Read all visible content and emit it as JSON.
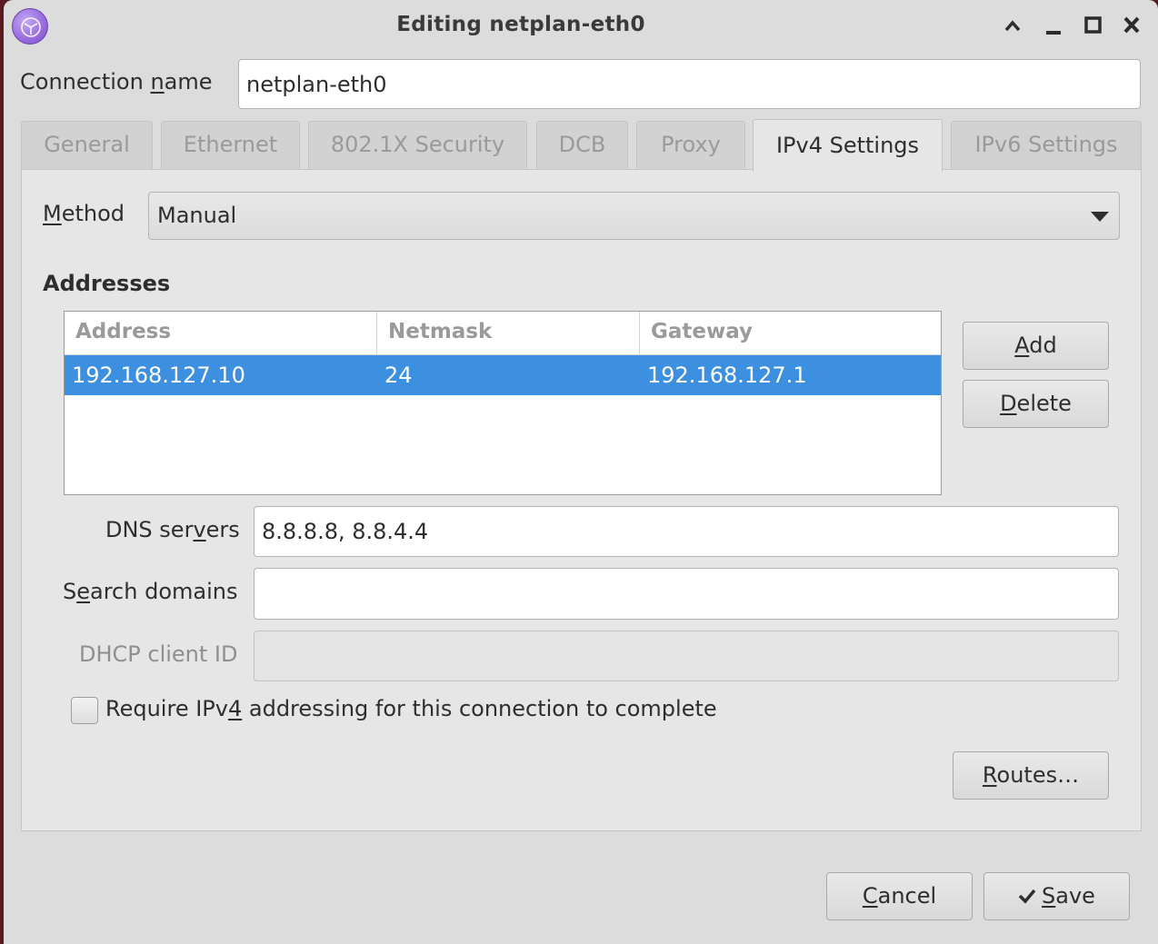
{
  "window": {
    "title": "Editing netplan-eth0",
    "controls": [
      "chevron-up-icon",
      "minimize-icon",
      "maximize-icon",
      "close-icon"
    ]
  },
  "connection": {
    "label_pre": "Connection ",
    "label_mnemonic": "n",
    "label_post": "ame",
    "value": "netplan-eth0"
  },
  "tabs": [
    {
      "label": "General",
      "active": false
    },
    {
      "label": "Ethernet",
      "active": false
    },
    {
      "label": "802.1X Security",
      "active": false
    },
    {
      "label": "DCB",
      "active": false
    },
    {
      "label": "Proxy",
      "active": false
    },
    {
      "label": "IPv4 Settings",
      "active": true
    },
    {
      "label": "IPv6 Settings",
      "active": false
    }
  ],
  "ipv4": {
    "method_label_mnemonic": "M",
    "method_label_post": "ethod",
    "method_value": "Manual",
    "addresses_heading": "Addresses",
    "columns": [
      "Address",
      "Netmask",
      "Gateway"
    ],
    "rows": [
      {
        "address": "192.168.127.10",
        "netmask": "24",
        "gateway": "192.168.127.1",
        "selected": true
      }
    ],
    "add_mnemonic": "A",
    "add_post": "dd",
    "delete_mnemonic": "D",
    "delete_post": "elete",
    "dns_label_pre": "DNS ser",
    "dns_label_mnemonic": "v",
    "dns_label_post": "ers",
    "dns_value": "8.8.8.8, 8.8.4.4",
    "search_label_pre": "S",
    "search_label_mnemonic": "e",
    "search_label_post": "arch domains",
    "search_value": "",
    "dhcp_label": "DHCP client ID",
    "dhcp_value": "",
    "require_pre": "Require IPv",
    "require_mnemonic": "4",
    "require_post": " addressing for this connection to complete",
    "require_checked": false,
    "routes_mnemonic": "R",
    "routes_post": "outes…"
  },
  "footer": {
    "cancel_mnemonic": "C",
    "cancel_post": "ancel",
    "save_mnemonic": "S",
    "save_post": "ave",
    "save_icon": "check-icon"
  },
  "colors": {
    "selection": "#3d8fe0",
    "window_bg": "#dcdcdc",
    "app_icon": "#9a6fe0"
  }
}
